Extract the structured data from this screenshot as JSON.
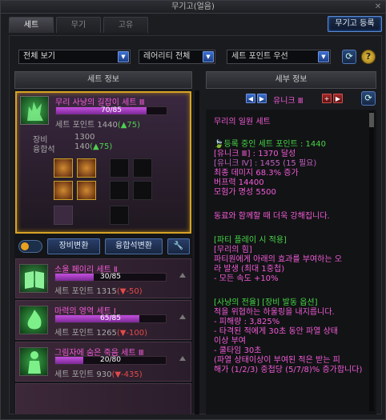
{
  "window": {
    "title": "무기고(얼음)",
    "close": "✕"
  },
  "tabs": [
    "세트",
    "무기",
    "고유"
  ],
  "register_button": "무기고 등록",
  "filters": {
    "view": "전체 보기",
    "rarity": "레어리티 전체",
    "sort": "세트 포인트 우선"
  },
  "left_header": "세트 정보",
  "right_header": "세부 정보",
  "selected_set": {
    "name": "무리 사냥의 길잡이 세트 Ⅲ",
    "progress_text": "70/85",
    "progress": 0.82,
    "points_label": "세트 포인트",
    "points": "1440",
    "delta": "(▲75)",
    "equip_label": "장비",
    "equip_value": "1300",
    "fusion_label": "융합석",
    "fusion_value": "140",
    "fusion_delta": "(▲75)"
  },
  "actions": {
    "equip_change": "장비변환",
    "fusion_change": "융합석변환",
    "toggle": "toggle",
    "wrench": "wrench-icon"
  },
  "sets": [
    {
      "name": "소울 페이리 세트 Ⅱ",
      "progress_text": "30/85",
      "progress": 0.35,
      "points_label": "세트 포인트",
      "points": "1315",
      "delta": "(▼-50)",
      "icon": "book-icon"
    },
    {
      "name": "마력의 영역 세트 Ⅰ",
      "progress_text": "65/85",
      "progress": 0.76,
      "points_label": "세트 포인트",
      "points": "1265",
      "delta": "(▼-100)",
      "icon": "flame-icon"
    },
    {
      "name": "그림자에 숨은 죽음 세트 Ⅲ",
      "progress_text": "20/80",
      "progress": 0.25,
      "points_label": "세트 포인트",
      "points": "930",
      "delta": "(▼-435)",
      "icon": "figure-icon"
    }
  ],
  "detail": {
    "rarity": "유니크 Ⅲ",
    "title": "무리의 일원 세트",
    "points_line": "등록 중인 세트 포인트 : 1440",
    "unique3": "[유니크 Ⅲ] : 1370 달성",
    "unique4": "[유니크 Ⅳ] : 1455 (15 필요)",
    "max_dmg": "최종 데미지 68.3% 증가",
    "buff": "버프력 14400",
    "fame": "모험가 명성 5500",
    "companion": "동료와 함께할 때 더욱 강해집니다.",
    "party_head": "[파티 플레이 시 적용]",
    "party_sub": "[무리의 힘]",
    "party_line1": "파티원에게 아래의 효과를 부여하는 오",
    "party_line2": "라 발생 (최대 1중첩)",
    "party_line3": "- 모든 속도 +10%",
    "hunt_head": "[사냥의 전율] [장비 발동 옵션]",
    "hunt_line1": "적을 위협하는 하울링을 내지릅니다.",
    "hunt_line2": "- 피해량 : 3,825%",
    "hunt_line3": "- 타격된 적에게 30초 동안 파열 상태",
    "hunt_line4": "이상 부여",
    "hunt_line5": "- 쿨타임 30초",
    "hunt_line6": "(파열 상태이상이 부여된 적은 받는 피",
    "hunt_line7": "해가 (1/2/3) 중첩당 (5/7/8)% 증가합니다)"
  },
  "colors": {
    "magenta": "#f25bd8",
    "green": "#46d646",
    "gold": "#d7a326",
    "red": "#e24a4a"
  }
}
